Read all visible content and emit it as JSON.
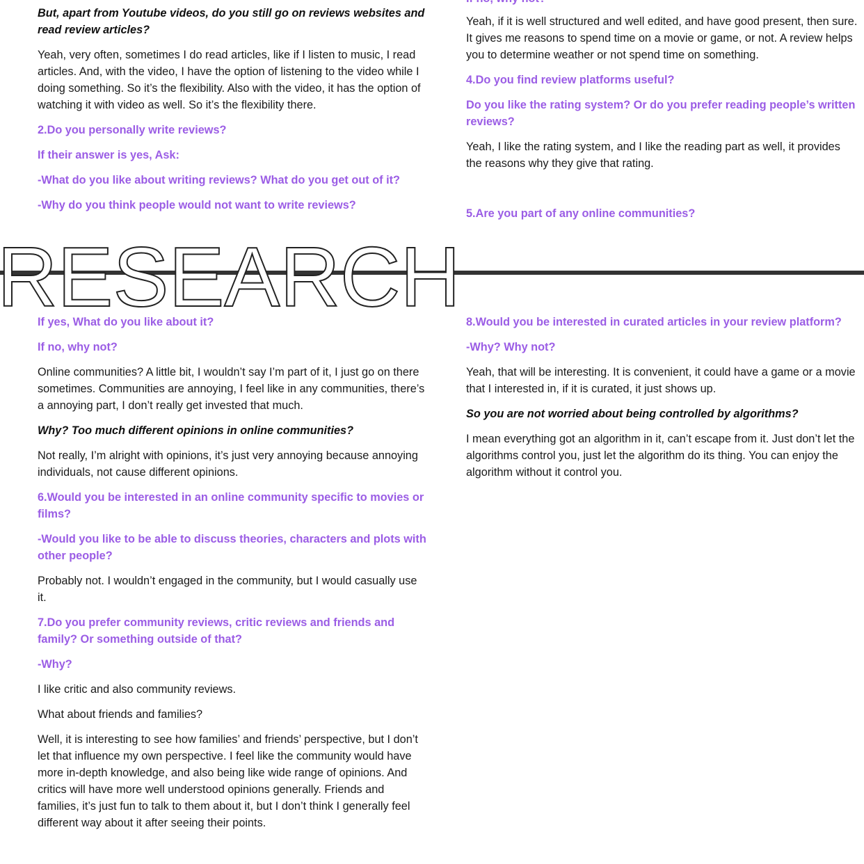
{
  "top_left": {
    "q_intro": "But, apart from Youtube videos, do you still go on reviews websites and read review articles?",
    "a_intro": "Yeah, very often, sometimes I do read articles, like if I listen to music, I read articles. And, with the video, I have the option of listening to the video while I doing something. So it’s the flexibility. Also with the video, it has the option of watching it with video as well. So it’s the flexibility there.",
    "q2": "2.Do you personally write reviews?",
    "q2_follow": "If their answer is yes, Ask:",
    "q2_sub1": "-What do you like about writing reviews? What do you get out of it?",
    "q2_sub2": "-Why do you think people would not want to write reviews?"
  },
  "top_right": {
    "cut_heading": "If no, why not?",
    "a3": "Yeah, if it is well structured and well edited, and have good present, then sure. It gives me reasons to spend time on a movie or game, or not. A review helps you to determine weather or not spend time on something.",
    "q4": "4.Do you find review platforms useful?",
    "q4_sub": "Do you like the rating system? Or do you prefer reading people’s written reviews?",
    "a4": "Yeah, I like the rating system, and I like the reading part as well, it provides the reasons why they give that rating.",
    "q5": "5.Are you part of any online communities?"
  },
  "banner": {
    "word": "RESEARCH"
  },
  "bottom_left": {
    "q5_yes": "If yes, What do you like about it?",
    "q5_no": "If no, why not?",
    "a5": "Online communities? A little bit, I wouldn’t say I’m part of it, I just go on there sometimes. Communities are annoying, I feel like in any communities, there’s a annoying part, I don’t really get invested that much.",
    "q5_probe": "Why? Too much different opinions in online communities?",
    "a5_probe": "Not really, I’m alright with opinions, it’s just very annoying because annoying individuals, not cause different opinions.",
    "q6": "6.Would you be interested in an online community specific to movies or films?",
    "q6_sub": "-Would you like to be able to discuss theories, characters and plots with other people?",
    "a6": "Probably not. I wouldn’t engaged in the community, but I would casually use it.",
    "q7": "7.Do you prefer community reviews, critic reviews and friends and family? Or something outside of that?",
    "q7_sub": "-Why?",
    "a7": "I like critic and also community reviews.",
    "q7_probe": "What about friends and families?",
    "a7_probe": "Well, it is interesting to see how families’ and friends’ perspective, but I don’t let that influence my own perspective. I feel like the community would have more in-depth knowledge, and also being like wide range of opinions. And critics will have more well understood opinions generally. Friends and families, it’s just fun to talk to them about it, but I don’t think I generally feel different way about it after seeing their points."
  },
  "bottom_right": {
    "q8": "8.Would you be interested in curated articles in your review platform?",
    "q8_sub": "-Why? Why not?",
    "a8": "Yeah, that will be interesting. It is convenient, it could have a game or a movie that I interested in, if it is curated, it just shows up.",
    "q8_probe": "So you are not worried about being controlled by algorithms?",
    "a8_probe": "I mean everything got an algorithm in it, can’t escape from it. Just don’t let the algorithms control you, just let the algorithm do its thing. You can enjoy the algorithm without it control you."
  },
  "colors": {
    "question": "#9b5de5",
    "text": "#1a1a1a",
    "banner_line": "#333333"
  }
}
